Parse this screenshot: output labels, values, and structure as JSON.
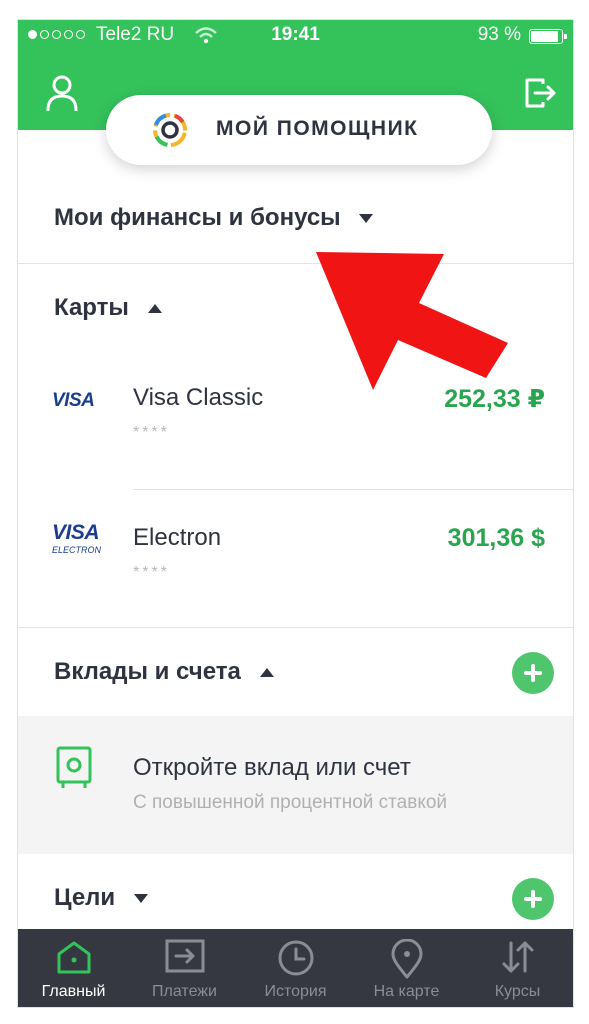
{
  "status_bar": {
    "carrier": "Tele2 RU",
    "time": "19:41",
    "battery": "93 %",
    "battery_level": 0.93,
    "signal_bars": 1
  },
  "header": {
    "assistant_label": "МОЙ ПОМОЩНИК"
  },
  "finance": {
    "title": "Мои финансы и бонусы"
  },
  "cards": {
    "title": "Карты",
    "items": [
      {
        "brand": "VISA",
        "name": "Visa Classic",
        "mask": "****",
        "amount": "252,33 ₽"
      },
      {
        "brand": "VISA",
        "brand_sub": "ELECTRON",
        "name": "Electron",
        "mask": "****",
        "amount": "301,36 $"
      }
    ]
  },
  "deposits": {
    "title": "Вклады и счета",
    "promo_title": "Откройте вклад или счет",
    "promo_subtitle": "С повышенной процентной ставкой"
  },
  "goals": {
    "title": "Цели"
  },
  "nav": [
    {
      "label": "Главный",
      "icon": "home-icon",
      "active": true
    },
    {
      "label": "Платежи",
      "icon": "payments-icon",
      "active": false
    },
    {
      "label": "История",
      "icon": "clock-icon",
      "active": false
    },
    {
      "label": "На карте",
      "icon": "map-pin-icon",
      "active": false
    },
    {
      "label": "Курсы",
      "icon": "exchange-arrows-icon",
      "active": false
    }
  ],
  "colors": {
    "brand_green": "#34c25b",
    "amount_green": "#2aa54f",
    "nav_bg": "#353841",
    "annotation_red": "#f01414"
  }
}
